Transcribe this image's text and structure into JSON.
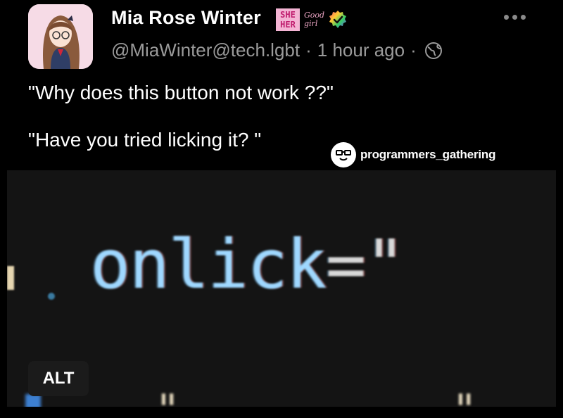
{
  "post": {
    "display_name": "Mia Rose Winter",
    "badge_pronouns": [
      "SHE",
      "HER"
    ],
    "badge_goodgirl": [
      "Good",
      "girl"
    ],
    "handle": "@MiaWinter@tech.lgbt",
    "separator": "·",
    "time": "1 hour ago",
    "text_line1": "\"Why does this button not work ??\"",
    "text_line2": "\"Have you tried licking it? \""
  },
  "watermark": {
    "text": "programmers_gathering"
  },
  "media": {
    "code_text": "onlick",
    "code_suffix": "=\"",
    "alt_button": "ALT"
  },
  "icons": {
    "more": "more-horizontal-icon",
    "visibility": "globe-icon",
    "verified": "verified-badge-icon"
  },
  "colors": {
    "background": "#000000",
    "meta_text": "#9a9a9a",
    "code_text": "#9fd8ff"
  }
}
